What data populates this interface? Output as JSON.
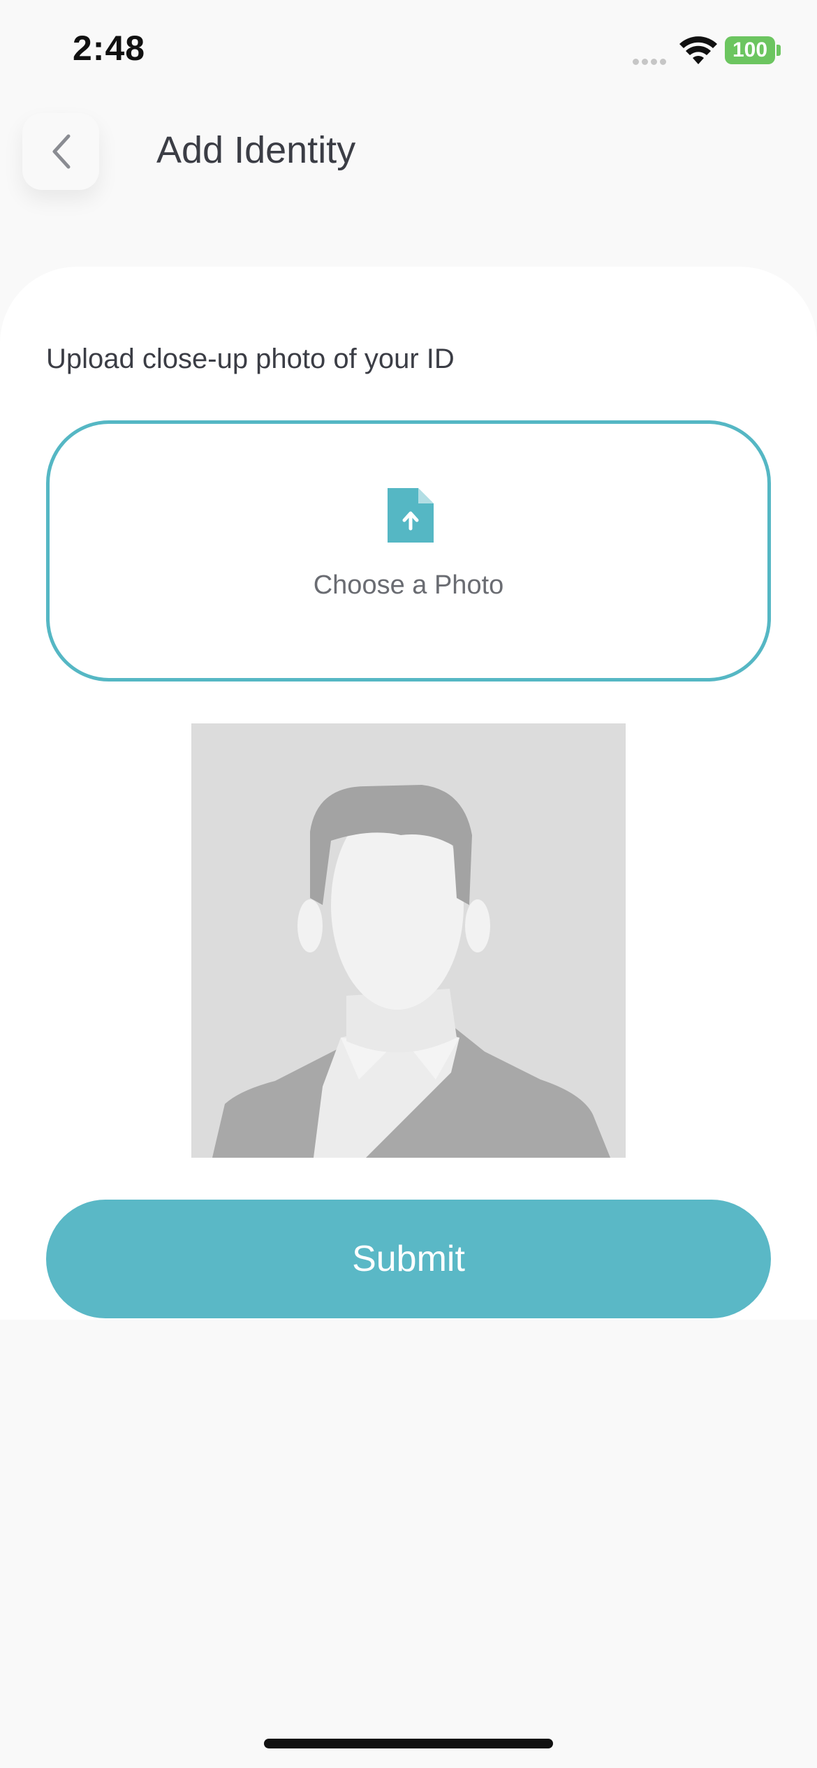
{
  "status_bar": {
    "time": "2:48",
    "battery": "100"
  },
  "header": {
    "title": "Add Identity"
  },
  "upload": {
    "label": "Upload close-up photo of your ID",
    "button_text": "Choose a Photo",
    "icon": "file-upload-icon"
  },
  "placeholder_photo": {
    "icon": "person-silhouette"
  },
  "actions": {
    "submit_label": "Submit"
  },
  "colors": {
    "accent": "#5ab8c6",
    "border": "#55b7c4",
    "background": "#f9f9f9",
    "card": "#ffffff",
    "battery": "#6cc560"
  }
}
